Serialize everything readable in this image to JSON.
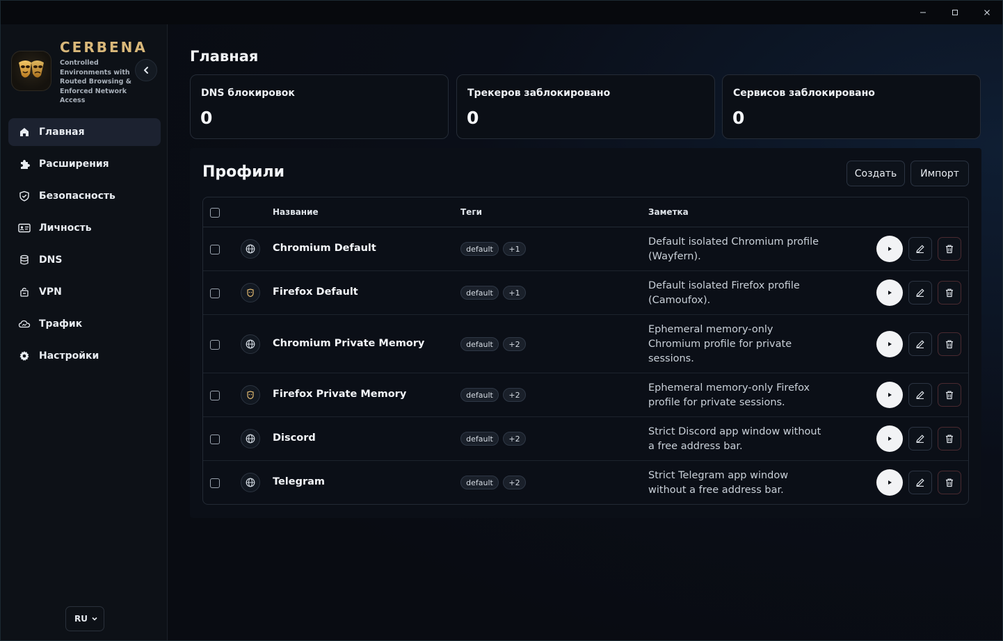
{
  "window": {
    "controls": {
      "minimize": "minimize-icon",
      "maximize": "maximize-icon",
      "close": "close-icon"
    }
  },
  "sidebar": {
    "brand_name": "CERBENA",
    "brand_sub": "Controlled Environments with Routed Browsing & Enforced Network Access",
    "items": [
      {
        "label": "Главная",
        "icon": "home-icon",
        "active": true
      },
      {
        "label": "Расширения",
        "icon": "puzzle-icon",
        "active": false
      },
      {
        "label": "Безопасность",
        "icon": "shield-icon",
        "active": false
      },
      {
        "label": "Личность",
        "icon": "id-card-icon",
        "active": false
      },
      {
        "label": "DNS",
        "icon": "database-icon",
        "active": false
      },
      {
        "label": "VPN",
        "icon": "vpn-icon",
        "active": false
      },
      {
        "label": "Трафик",
        "icon": "cloud-traffic-icon",
        "active": false
      },
      {
        "label": "Настройки",
        "icon": "gear-icon",
        "active": false
      }
    ],
    "language": "RU"
  },
  "main": {
    "title": "Главная",
    "stats": [
      {
        "label": "DNS блокировок",
        "value": "0"
      },
      {
        "label": "Трекеров заблокировано",
        "value": "0"
      },
      {
        "label": "Сервисов заблокировано",
        "value": "0"
      }
    ],
    "profiles": {
      "title": "Профили",
      "create_label": "Создать",
      "import_label": "Импорт",
      "columns": {
        "name": "Название",
        "tags": "Теги",
        "note": "Заметка"
      },
      "rows": [
        {
          "name": "Chromium Default",
          "engine": "globe-icon",
          "tag": "default",
          "extra": "+1",
          "note": "Default isolated Chromium profile (Wayfern)."
        },
        {
          "name": "Firefox Default",
          "engine": "fox-mask-icon",
          "tag": "default",
          "extra": "+1",
          "note": "Default isolated Firefox profile (Camoufox)."
        },
        {
          "name": "Chromium Private Memory",
          "engine": "globe-icon",
          "tag": "default",
          "extra": "+2",
          "note": "Ephemeral memory-only Chromium profile for private sessions."
        },
        {
          "name": "Firefox Private Memory",
          "engine": "fox-mask-icon",
          "tag": "default",
          "extra": "+2",
          "note": "Ephemeral memory-only Firefox profile for private sessions."
        },
        {
          "name": "Discord",
          "engine": "globe-icon",
          "tag": "default",
          "extra": "+2",
          "note": "Strict Discord app window without a free address bar."
        },
        {
          "name": "Telegram",
          "engine": "globe-icon",
          "tag": "default",
          "extra": "+2",
          "note": "Strict Telegram app window without a free address bar."
        }
      ]
    }
  }
}
